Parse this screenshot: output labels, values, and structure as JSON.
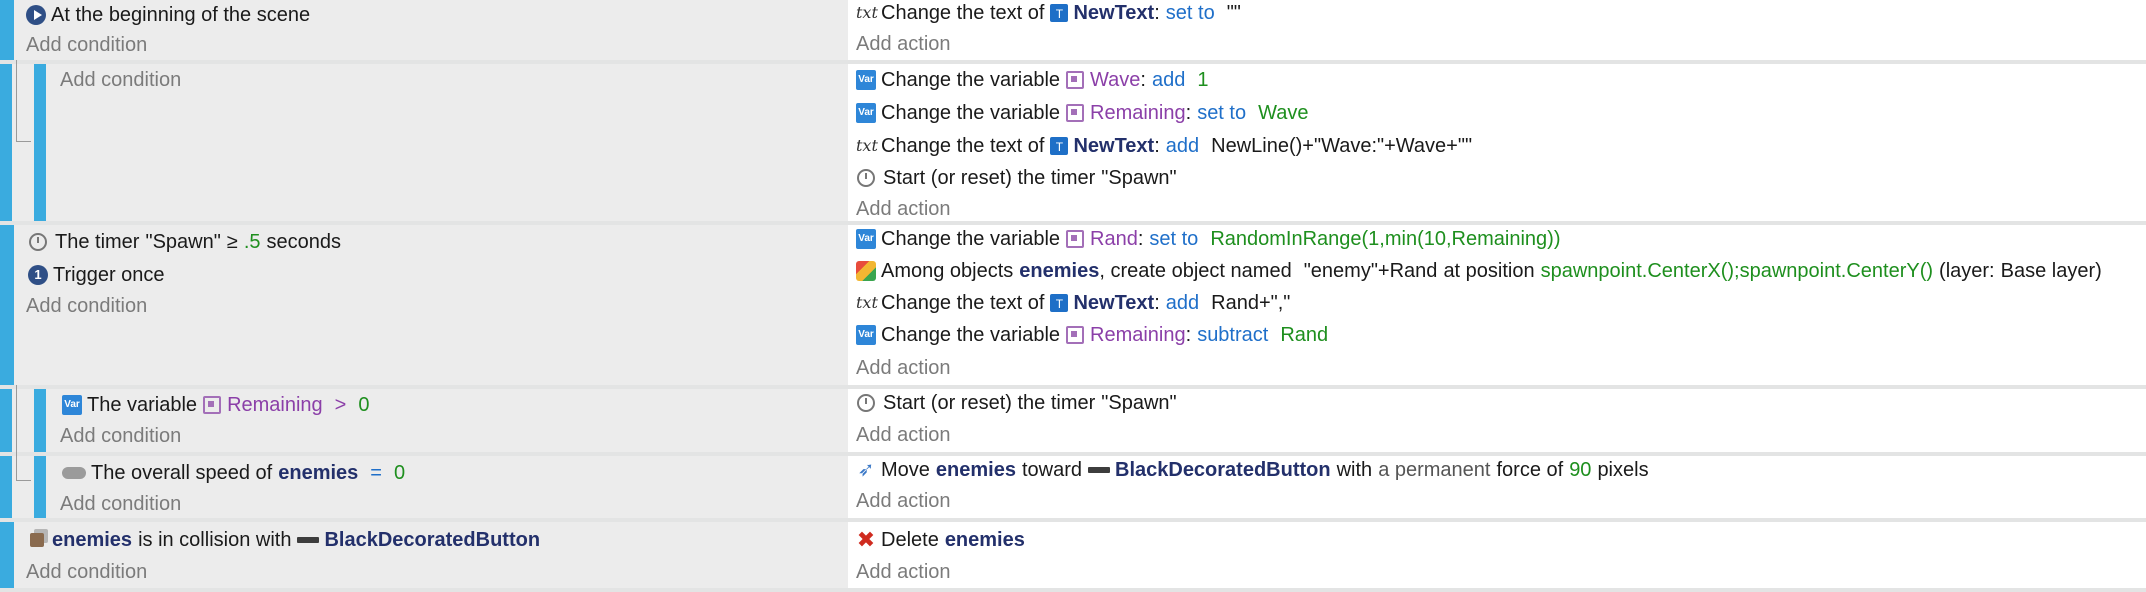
{
  "add_condition_label": "Add condition",
  "add_action_label": "Add action",
  "colors": {
    "event_bar": "#3aabdf",
    "keyword": "#1f6fc9",
    "value": "#1e8f1e",
    "variable": "#8b3fa8",
    "object": "#23306b",
    "delete": "#cf2b1f"
  },
  "events": [
    {
      "conditions": [
        {
          "icon": "play-circle-icon",
          "text": "At the beginning of the scene"
        }
      ],
      "actions": [
        {
          "icon": "text-icon",
          "p1": "Change the text of",
          "obj_icon": "sprite-icon",
          "obj": "NewText",
          "colon": ":",
          "op": "set to",
          "val": "\"\""
        }
      ]
    },
    {
      "conditions": [],
      "actions": [
        {
          "icon": "variable-icon",
          "p1": "Change the variable",
          "var_icon": "scene-variable-icon",
          "var": "Wave",
          "colon": ":",
          "op": "add",
          "val": "1"
        },
        {
          "icon": "variable-icon",
          "p1": "Change the variable",
          "var_icon": "scene-variable-icon",
          "var": "Remaining",
          "colon": ":",
          "op": "set to",
          "val": "Wave"
        },
        {
          "icon": "text-icon",
          "p1": "Change the text of",
          "obj_icon": "sprite-icon",
          "obj": "NewText",
          "colon": ":",
          "op": "add",
          "val": "NewLine()+\"Wave:\"+Wave+\"\""
        },
        {
          "icon": "timer-icon",
          "p1": "Start (or reset) the timer",
          "val": "\"Spawn\""
        }
      ]
    },
    {
      "conditions": [
        {
          "icon": "timer-icon",
          "p1": "The timer",
          "p2": "\"Spawn\"",
          "p3": "≥",
          "val": ".5",
          "p4": "seconds"
        },
        {
          "icon": "trigger-once-icon",
          "text": "Trigger once"
        }
      ],
      "actions": [
        {
          "icon": "variable-icon",
          "p1": "Change the variable",
          "var_icon": "scene-variable-icon",
          "var": "Rand",
          "colon": ":",
          "op": "set to",
          "val": "RandomInRange(1,min(10,Remaining))"
        },
        {
          "icon": "create-object-icon",
          "p1": "Among objects",
          "obj": "enemies",
          "p2": ", create object named",
          "p3": "\"enemy\"+Rand",
          "p4": "at position",
          "val": "spawnpoint.CenterX();spawnpoint.CenterY()",
          "p5": "(layer:",
          "p6": "Base layer)"
        },
        {
          "icon": "text-icon",
          "p1": "Change the text of",
          "obj_icon": "sprite-icon",
          "obj": "NewText",
          "colon": ":",
          "op": "add",
          "val": "Rand+\",\""
        },
        {
          "icon": "variable-icon",
          "p1": "Change the variable",
          "var_icon": "scene-variable-icon",
          "var": "Remaining",
          "colon": ":",
          "op": "subtract",
          "val": "Rand"
        }
      ]
    },
    {
      "conditions": [
        {
          "icon": "variable-icon",
          "p1": "The variable",
          "var_icon": "scene-variable-icon",
          "var": "Remaining",
          "op": ">",
          "val": "0"
        }
      ],
      "actions": [
        {
          "icon": "timer-icon",
          "p1": "Start (or reset) the timer",
          "val": "\"Spawn\""
        }
      ]
    },
    {
      "conditions": [
        {
          "icon": "speed-icon",
          "p1": "The overall speed of",
          "obj": "enemies",
          "op": "=",
          "val": "0"
        }
      ],
      "actions": [
        {
          "icon": "force-icon",
          "p1": "Move",
          "obj": "enemies",
          "p2": "toward",
          "obj2_icon": "button-bar-icon",
          "obj2": "BlackDecoratedButton",
          "p3": "with",
          "p4": "a permanent",
          "p5": "force of",
          "val": "90",
          "p6": "pixels"
        }
      ]
    },
    {
      "conditions": [
        {
          "icon": "collision-icon",
          "obj": "enemies",
          "p1": "is in collision with",
          "obj2_icon": "button-bar-icon",
          "obj2": "BlackDecoratedButton"
        }
      ],
      "actions": [
        {
          "icon": "delete-icon",
          "p1": "Delete",
          "obj": "enemies"
        }
      ]
    }
  ]
}
